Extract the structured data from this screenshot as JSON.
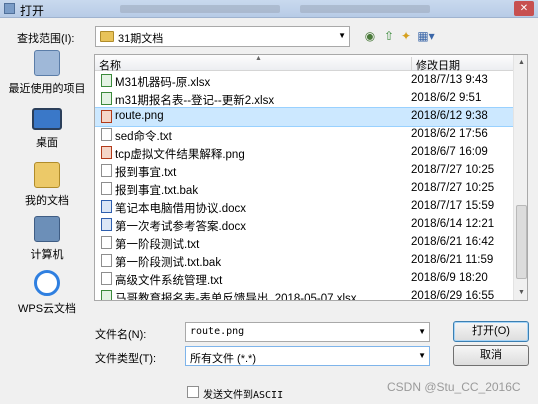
{
  "window": {
    "title": "打开"
  },
  "lookin": {
    "label": "查找范围(I):",
    "value": "31期文档"
  },
  "places": [
    {
      "label": "最近使用的项目",
      "icon": "recent-items-icon"
    },
    {
      "label": "桌面",
      "icon": "desktop-icon"
    },
    {
      "label": "我的文档",
      "icon": "documents-folder-icon"
    },
    {
      "label": "计算机",
      "icon": "computer-icon"
    },
    {
      "label": "WPS云文档",
      "icon": "cloud-icon"
    }
  ],
  "columns": {
    "name": "名称",
    "date": "修改日期"
  },
  "files": [
    {
      "name": "M31机器码-原.xlsx",
      "date": "2018/7/13 9:43",
      "type": "xlsx"
    },
    {
      "name": "m31期报名表--登记--更新2.xlsx",
      "date": "2018/6/2 9:51",
      "type": "xlsx"
    },
    {
      "name": "route.png",
      "date": "2018/6/12 9:38",
      "type": "png"
    },
    {
      "name": "sed命令.txt",
      "date": "2018/6/2 17:56",
      "type": "txt"
    },
    {
      "name": "tcp虚拟文件结果解释.png",
      "date": "2018/6/7 16:09",
      "type": "png"
    },
    {
      "name": "报到事宜.txt",
      "date": "2018/7/27 10:25",
      "type": "txt"
    },
    {
      "name": "报到事宜.txt.bak",
      "date": "2018/7/27 10:25",
      "type": "txt"
    },
    {
      "name": "笔记本电脑借用协议.docx",
      "date": "2018/7/17 15:59",
      "type": "docx"
    },
    {
      "name": "第一次考试参考答案.docx",
      "date": "2018/6/14 12:21",
      "type": "docx"
    },
    {
      "name": "第一阶段测试.txt",
      "date": "2018/6/21 16:42",
      "type": "txt"
    },
    {
      "name": "第一阶段测试.txt.bak",
      "date": "2018/6/21 11:59",
      "type": "txt"
    },
    {
      "name": "高级文件系统管理.txt",
      "date": "2018/6/9 18:20",
      "type": "txt"
    },
    {
      "name": "马哥教育报名表-表单反馈导出_2018-05-07.xlsx",
      "date": "2018/6/29 16:55",
      "type": "xlsx"
    }
  ],
  "selected_file": "route.png",
  "filename": {
    "label": "文件名(N):",
    "value": "route.png"
  },
  "filetype": {
    "label": "文件类型(T):",
    "value": "所有文件 (*.*)"
  },
  "buttons": {
    "open": "打开(O)",
    "cancel": "取消"
  },
  "checkbox": {
    "label": "发送文件到ASCII",
    "checked": false
  },
  "watermark": "CSDN @Stu_CC_2016C",
  "colors": {
    "selection": "#cce8ff",
    "titlebar": "#b7cbe6",
    "folder": "#e8c35a"
  }
}
